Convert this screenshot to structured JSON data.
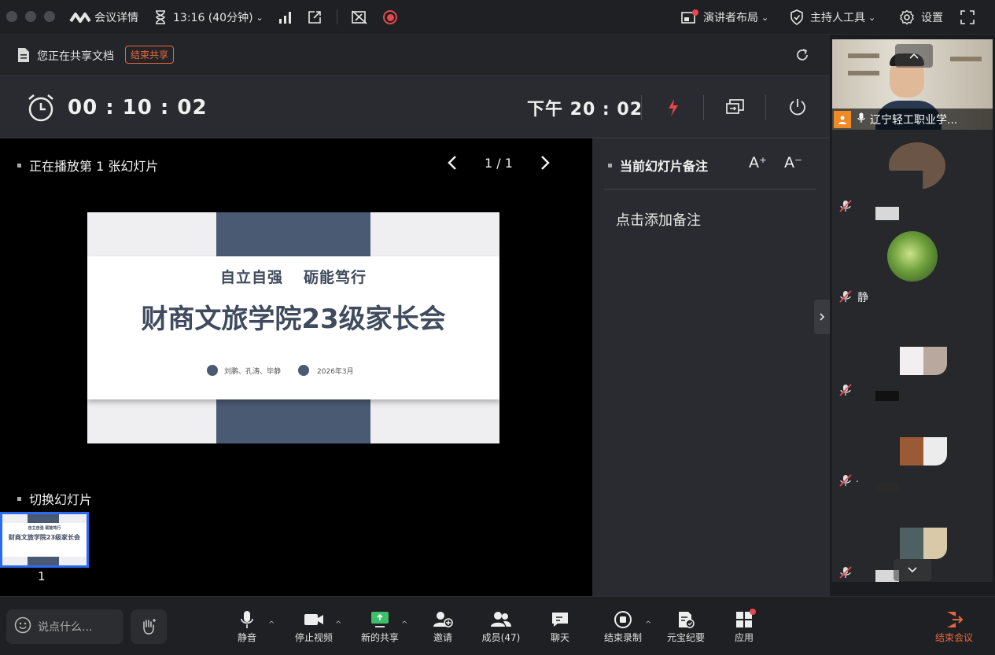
{
  "topbar": {
    "meeting_details": "会议详情",
    "elapsed": "13:16 (40分钟)",
    "presenter_layout": "演讲者布局",
    "host_tools": "主持人工具",
    "settings": "设置"
  },
  "sharebar": {
    "sharing_text": "您正在共享文档",
    "stop_share": "结束共享"
  },
  "timer": {
    "elapsed": "00 : 10 : 02",
    "clock": "下午 20 : 02"
  },
  "slideshow": {
    "playing_label": "正在播放第 1 张幻灯片",
    "page_indicator": "1 / 1",
    "switch_label": "切换幻灯片",
    "thumb_number": "1"
  },
  "slide": {
    "motto_left": "自立自强",
    "motto_right": "砺能笃行",
    "title": "财商文旅学院23级家长会",
    "authors": "刘鹏、孔涛、毕静",
    "date": "2026年3月"
  },
  "thumb_slide": {
    "motto_left": "自立自强",
    "motto_right": "砺能笃行",
    "title": "财商文旅学院23级家长会"
  },
  "notes": {
    "title": "当前幻灯片备注",
    "font_up": "A⁺",
    "font_down": "A⁻",
    "placeholder": "点击添加备注"
  },
  "participants": {
    "host_name": "辽宁轻工职业学...",
    "second_name": "静",
    "dot_name": "."
  },
  "toolbar": {
    "chat_placeholder": "说点什么...",
    "mute": "静音",
    "stop_video": "停止视频",
    "new_share": "新的共享",
    "invite": "邀请",
    "members": "成员(47)",
    "chat": "聊天",
    "end_record": "结束录制",
    "yuanbao": "元宝纪要",
    "apps": "应用",
    "end_meeting": "结束会议"
  },
  "colors": {
    "accent_red": "#e5484d",
    "end_meeting": "#e8663d",
    "thumb_border": "#2a6bf2",
    "slide_band": "#4a5a72"
  }
}
